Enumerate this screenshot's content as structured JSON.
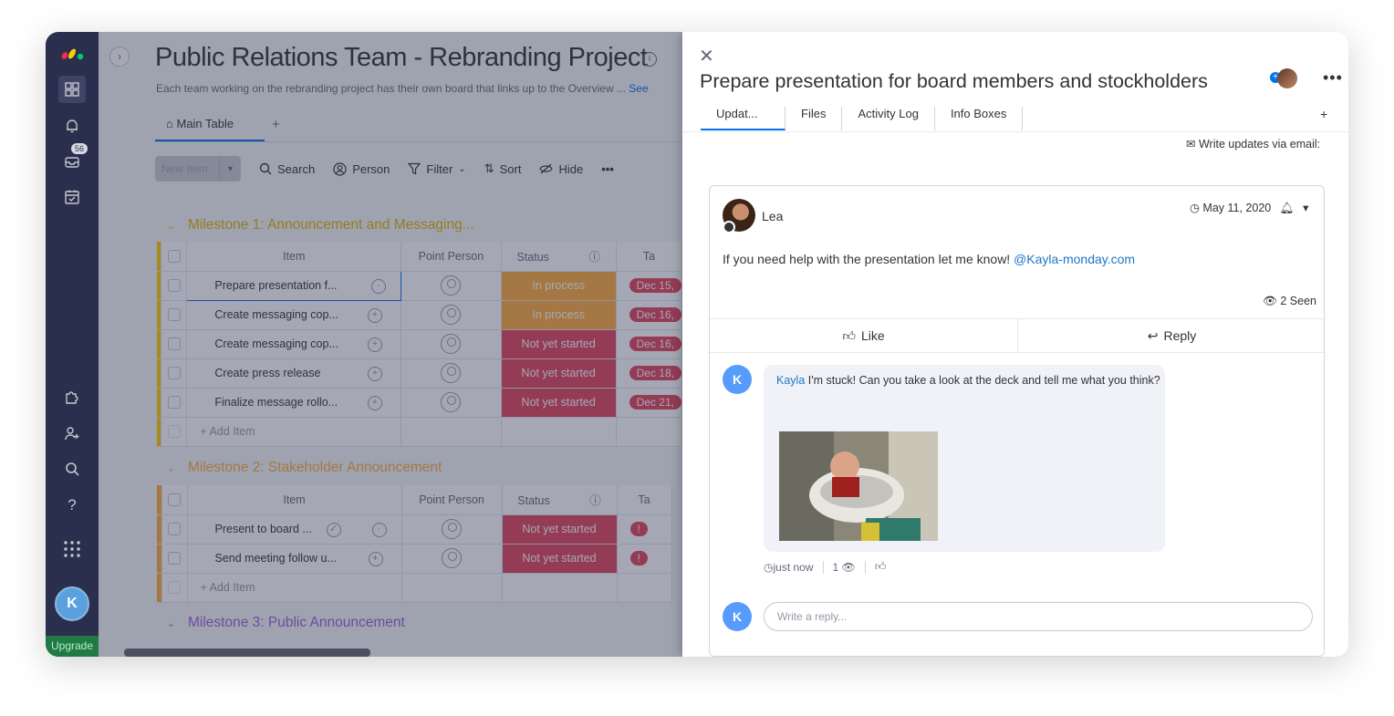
{
  "nav": {
    "inbox_badge": "56",
    "avatar_initial": "K",
    "upgrade_label": "Upgrade"
  },
  "board": {
    "title": "Public Relations Team - Rebranding Project",
    "description": "Each team working on the rebranding project has their own board that links up to the Overview ...",
    "see_more": "See",
    "main_tab": "Main Table",
    "add_tab": "+",
    "toolbar": {
      "new_item": "New Item",
      "search": "Search",
      "person": "Person",
      "filter": "Filter",
      "sort": "Sort",
      "hide": "Hide",
      "more": "•••"
    },
    "columns": {
      "item": "Item",
      "point_person": "Point Person",
      "status": "Status",
      "timeline": "Ta"
    },
    "add_item": "+ Add Item",
    "groups": [
      {
        "title": "Milestone 1: Announcement and Messaging...",
        "color": "#ffcb00",
        "rows": [
          {
            "name": "Prepare presentation f...",
            "status": "In process",
            "status_type": "proc",
            "date": "Dec 15,"
          },
          {
            "name": "Create messaging cop...",
            "status": "In process",
            "status_type": "proc",
            "date": "Dec 16,"
          },
          {
            "name": "Create messaging cop...",
            "status": "Not yet started",
            "status_type": "nys",
            "date": "Dec 16,"
          },
          {
            "name": "Create press release",
            "status": "Not yet started",
            "status_type": "nys",
            "date": "Dec 18,"
          },
          {
            "name": "Finalize message rollo...",
            "status": "Not yet started",
            "status_type": "nys",
            "date": "Dec 21,"
          }
        ]
      },
      {
        "title": "Milestone 2: Stakeholder Announcement",
        "color": "#fdab3d",
        "rows": [
          {
            "name": "Present to board ...",
            "status": "Not yet started",
            "status_type": "nys",
            "date": "!"
          },
          {
            "name": "Send meeting follow u...",
            "status": "Not yet started",
            "status_type": "nys",
            "date": "!"
          }
        ]
      },
      {
        "title": "Milestone 3: Public Announcement",
        "color": "#a25ddc",
        "rows": []
      }
    ]
  },
  "panel": {
    "title": "Prepare presentation for board members and stockholders",
    "tabs": [
      "Updat...",
      "Files",
      "Activity Log",
      "Info Boxes"
    ],
    "add_tab": "+",
    "email_updates": "Write updates via email:",
    "post": {
      "author": "Lea",
      "date": "May 11, 2020",
      "body": "If you need help with the presentation let me know!",
      "mention": "@Kayla-monday.com",
      "seen": "2 Seen",
      "like": "Like",
      "reply": "Reply"
    },
    "reply": {
      "avatar_initial": "K",
      "author": "Kayla",
      "text": "I'm stuck! Can you take a look at the deck and tell me what you think?",
      "time": "just now",
      "views": "1"
    },
    "write_reply_placeholder": "Write a reply...",
    "reply_avatar_initial": "K"
  }
}
